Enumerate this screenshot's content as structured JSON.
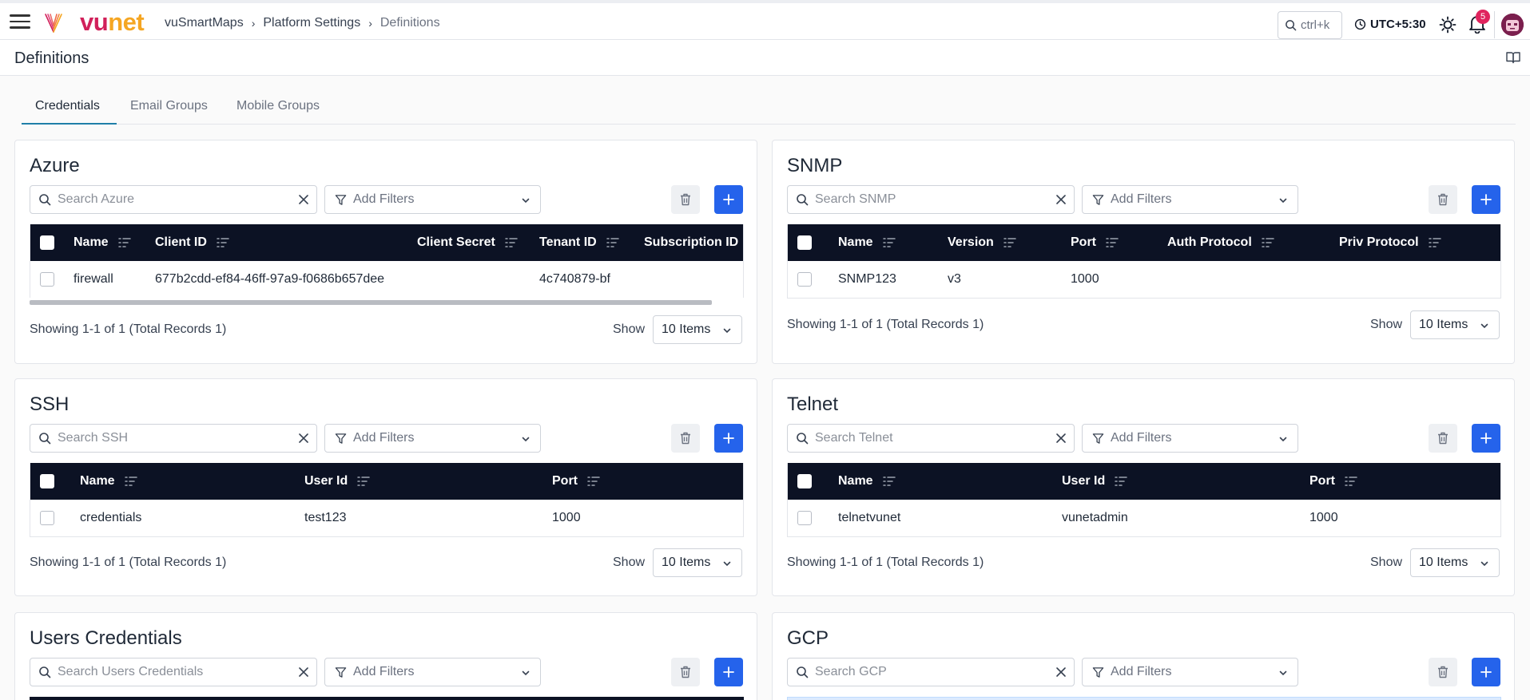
{
  "header": {
    "logo_text_a": "vu",
    "logo_text_b": "net",
    "breadcrumb": [
      "vuSmartMaps",
      "Platform Settings",
      "Definitions"
    ],
    "search_shortcut": "ctrl+k",
    "timezone": "UTC+5:30",
    "notification_count": "5"
  },
  "page": {
    "title": "Definitions"
  },
  "tabs": [
    {
      "label": "Credentials",
      "active": true
    },
    {
      "label": "Email Groups",
      "active": false
    },
    {
      "label": "Mobile Groups",
      "active": false
    }
  ],
  "common": {
    "add_filters": "Add Filters",
    "show_label": "Show",
    "show_value": "10 Items"
  },
  "cards": {
    "azure": {
      "title": "Azure",
      "search_placeholder": "Search Azure",
      "columns": [
        "Name",
        "Client ID",
        "Client Secret",
        "Tenant ID",
        "Subscription ID"
      ],
      "row": [
        "firewall",
        "677b2cdd-ef84-46ff-97a9-f0686b657dee",
        "",
        "4c740879-bf",
        ""
      ],
      "footer": "Showing 1-1 of 1 (Total Records 1)"
    },
    "snmp": {
      "title": "SNMP",
      "search_placeholder": "Search SNMP",
      "columns": [
        "Name",
        "Version",
        "Port",
        "Auth Protocol",
        "Priv Protocol"
      ],
      "row": [
        "SNMP123",
        "v3",
        "1000",
        "",
        ""
      ],
      "footer": "Showing 1-1 of 1 (Total Records 1)"
    },
    "ssh": {
      "title": "SSH",
      "search_placeholder": "Search SSH",
      "columns": [
        "Name",
        "User Id",
        "Port"
      ],
      "row": [
        "credentials",
        "test123",
        "1000"
      ],
      "footer": "Showing 1-1 of 1 (Total Records 1)"
    },
    "telnet": {
      "title": "Telnet",
      "search_placeholder": "Search Telnet",
      "columns": [
        "Name",
        "User Id",
        "Port"
      ],
      "row": [
        "telnetvunet",
        "vunetadmin",
        "1000"
      ],
      "footer": "Showing 1-1 of 1 (Total Records 1)"
    },
    "users": {
      "title": "Users Credentials",
      "search_placeholder": "Search Users Credentials"
    },
    "gcp": {
      "title": "GCP",
      "search_placeholder": "Search GCP"
    }
  },
  "colors": {
    "accent": "#2563eb",
    "table_header": "#0c1224",
    "brand_pink": "#d1205a",
    "brand_orange": "#f5a623"
  }
}
